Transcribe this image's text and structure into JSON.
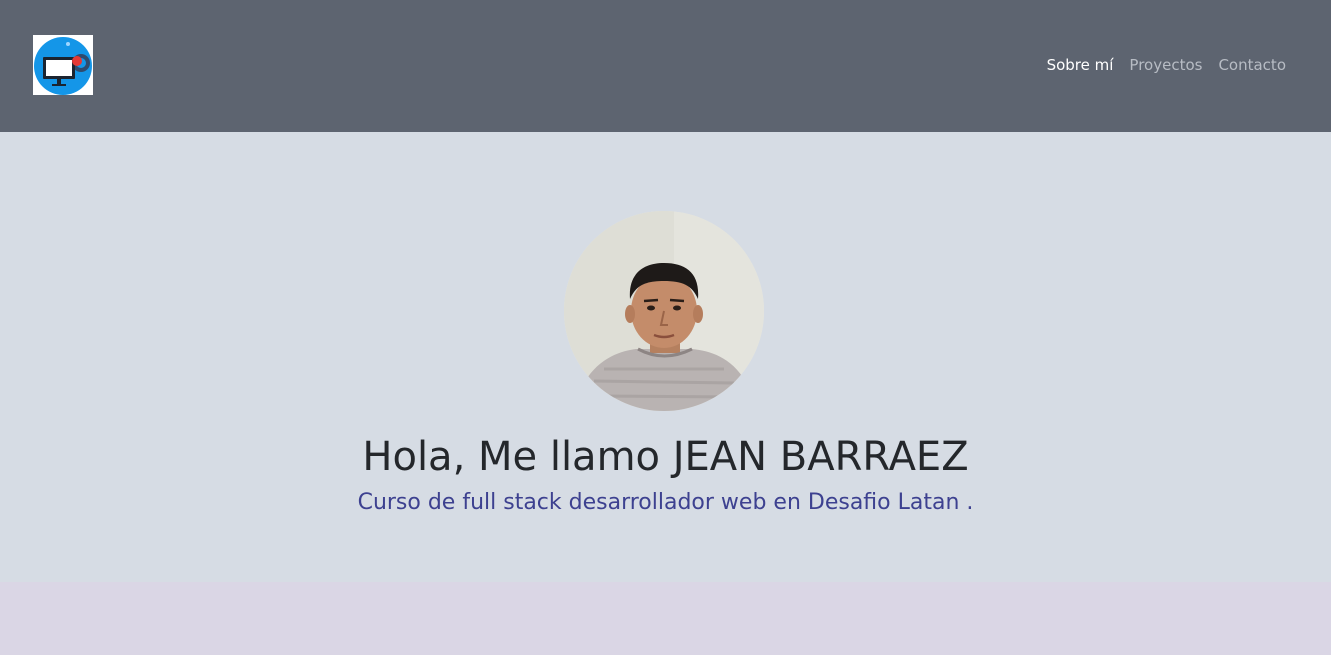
{
  "nav": {
    "logo_icon": "computer-gear-logo-icon",
    "links": [
      {
        "label": "Sobre mí",
        "active": true
      },
      {
        "label": "Proyectos",
        "active": false
      },
      {
        "label": "Contacto",
        "active": false
      }
    ]
  },
  "hero": {
    "avatar_icon": "profile-photo",
    "title": "Hola, Me llamo JEAN BARRAEZ",
    "subtitle": "Curso de full stack desarrollador web en Desafio Latan ."
  },
  "colors": {
    "navbar": "#5d6470",
    "hero_bg": "#d6dce4",
    "subtitle": "#3d4190",
    "next_section": "#dad6e5"
  }
}
